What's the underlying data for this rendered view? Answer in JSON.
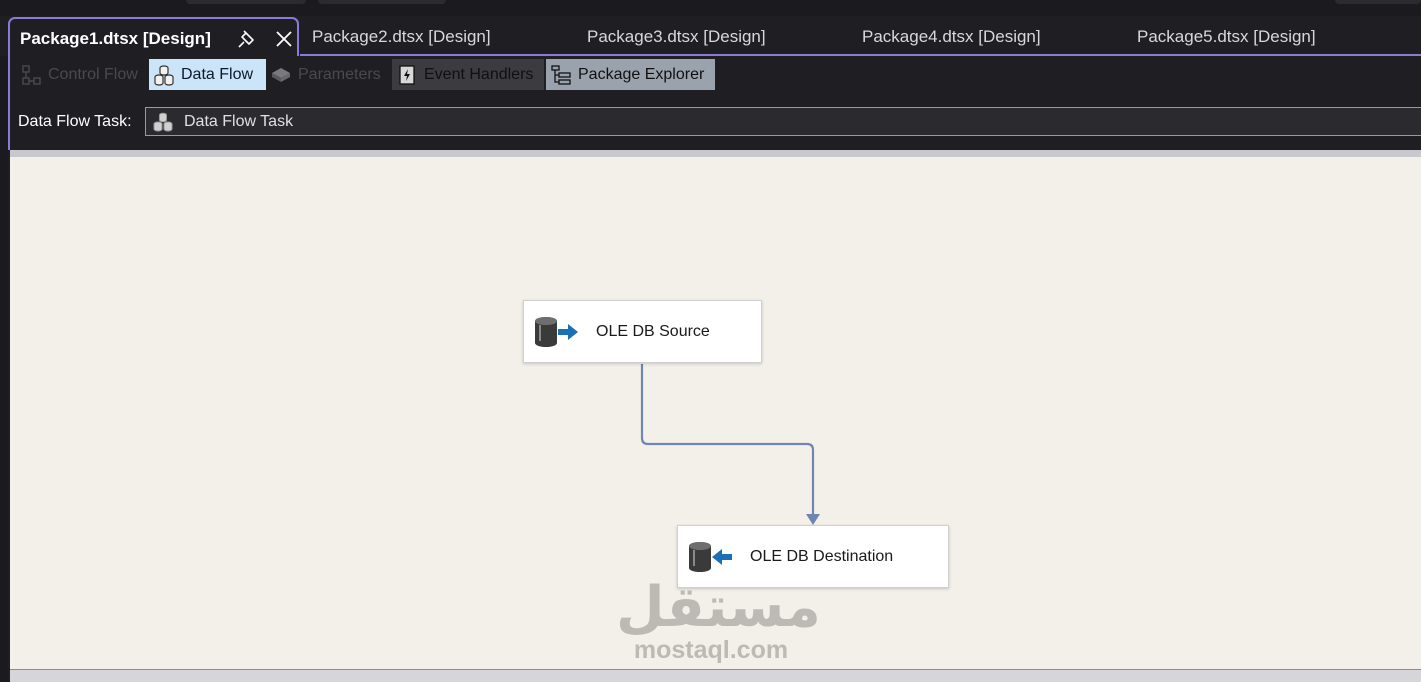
{
  "tabs": {
    "active": "Package1.dtsx [Design]",
    "others": [
      "Package2.dtsx [Design]",
      "Package3.dtsx [Design]",
      "Package4.dtsx [Design]",
      "Package5.dtsx [Design]"
    ]
  },
  "designer_tabs": {
    "control_flow": "Control Flow",
    "data_flow": "Data Flow",
    "parameters": "Parameters",
    "event_handlers": "Event Handlers",
    "package_explorer": "Package Explorer",
    "selected": "Data Flow"
  },
  "task_selector": {
    "label": "Data Flow Task:",
    "value": "Data Flow Task"
  },
  "components": {
    "source": "OLE DB Source",
    "destination": "OLE DB Destination"
  },
  "watermark": {
    "arabic": "مستقل",
    "latin": "mostaql.com"
  },
  "colors": {
    "accent": "#8b7ad8",
    "canvas": "#f3f0ea",
    "path_line": "#6d87b0",
    "selected_tab": "#cce4f7"
  }
}
